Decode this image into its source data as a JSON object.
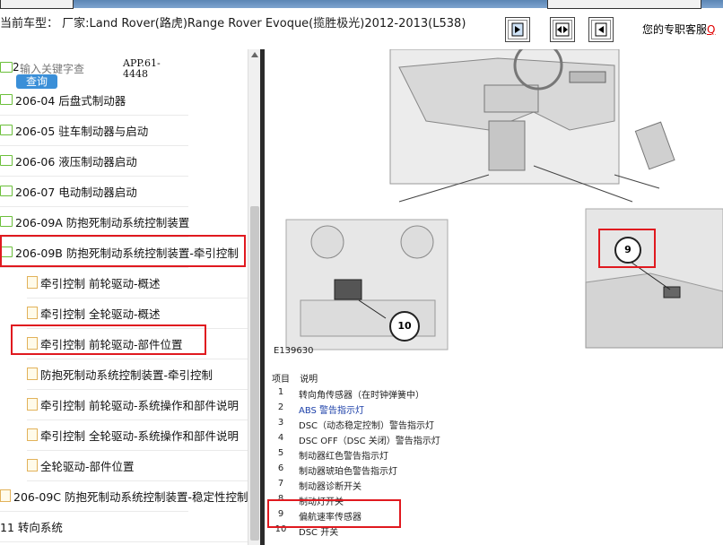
{
  "header": {
    "title": "当前车型： 厂家:Land Rover(路虎)Range Rover Evoque(揽胜极光)2012-2013(L538)",
    "support_label": "您的专职客服",
    "support_link": "Q"
  },
  "search": {
    "placeholder": "输入关键字查",
    "prefix": "2",
    "button": "查询",
    "code_line1": "APP.61-",
    "code_line2": "4448"
  },
  "tree": [
    {
      "label": "206-04 后盘式制动器",
      "type": "folder"
    },
    {
      "label": "206-05 驻车制动器与启动",
      "type": "folder"
    },
    {
      "label": "206-06 液压制动器启动",
      "type": "folder"
    },
    {
      "label": "206-07 电动制动器启动",
      "type": "folder"
    },
    {
      "label": "206-09A 防抱死制动系统控制装置",
      "type": "folder"
    },
    {
      "label": "206-09B 防抱死制动系统控制装置-牵引控制",
      "type": "folder"
    },
    {
      "label": "牵引控制 前轮驱动-概述",
      "type": "doc"
    },
    {
      "label": "牵引控制 全轮驱动-概述",
      "type": "doc"
    },
    {
      "label": "牵引控制 前轮驱动-部件位置",
      "type": "doc"
    },
    {
      "label": "防抱死制动系统控制装置-牵引控制",
      "type": "doc"
    },
    {
      "label": "牵引控制 前轮驱动-系统操作和部件说明",
      "type": "doc"
    },
    {
      "label": "牵引控制 全轮驱动-系统操作和部件说明",
      "type": "doc"
    },
    {
      "label": "全轮驱动-部件位置",
      "type": "doc"
    },
    {
      "label": "206-09C 防抱死制动系统控制装置-稳定性控制",
      "type": "doc"
    },
    {
      "label": "11 转向系统",
      "type": "folder"
    }
  ],
  "figure": {
    "code": "E139630",
    "callout_9": "9",
    "callout_10": "10"
  },
  "legend": {
    "col_item": "项目",
    "col_desc": "说明",
    "rows": [
      {
        "num": "1",
        "desc": "转向角传感器（在时钟弹簧中）"
      },
      {
        "num": "2",
        "desc": "ABS 警告指示灯"
      },
      {
        "num": "3",
        "desc": "DSC（动态稳定控制）警告指示灯"
      },
      {
        "num": "4",
        "desc": "DSC OFF（DSC 关闭）警告指示灯"
      },
      {
        "num": "5",
        "desc": "制动器红色警告指示灯"
      },
      {
        "num": "6",
        "desc": "制动器琥珀色警告指示灯"
      },
      {
        "num": "7",
        "desc": "制动器诊断开关"
      },
      {
        "num": "8",
        "desc": "制动灯开关"
      },
      {
        "num": "9",
        "desc": "偏航速率传感器"
      },
      {
        "num": "10",
        "desc": "DSC 开关"
      }
    ]
  },
  "colors": {
    "highlight": "#e0191f",
    "accent": "#3a8fd8",
    "abs_text": "#1b3fa8"
  }
}
